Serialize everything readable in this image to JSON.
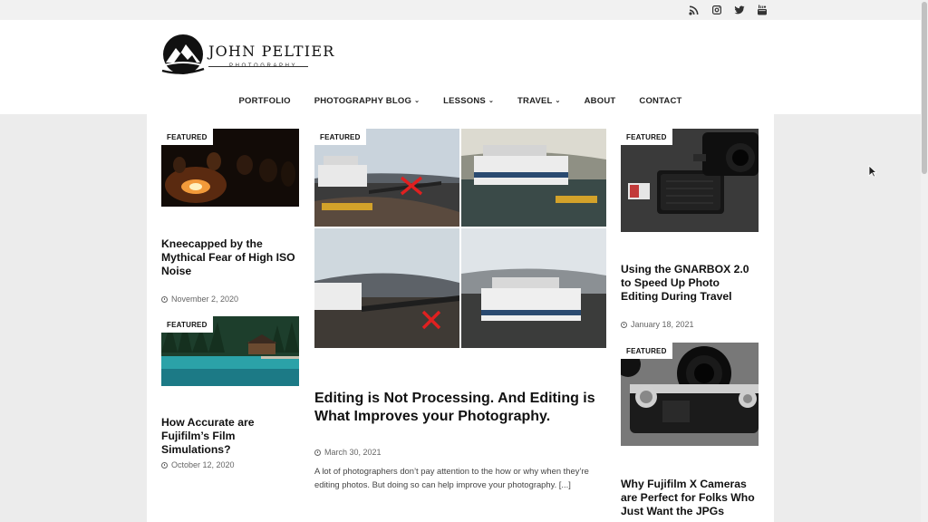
{
  "social": {
    "icons": [
      "rss-icon",
      "instagram-icon",
      "twitter-icon",
      "youtube-icon"
    ]
  },
  "logo": {
    "name": "JOHN PELTIER",
    "sub": "PHOTOGRAPHY"
  },
  "nav": {
    "items": [
      {
        "label": "PORTFOLIO",
        "dropdown": false
      },
      {
        "label": "PHOTOGRAPHY BLOG",
        "dropdown": true
      },
      {
        "label": "LESSONS",
        "dropdown": true
      },
      {
        "label": "TRAVEL",
        "dropdown": true
      },
      {
        "label": "ABOUT",
        "dropdown": false
      },
      {
        "label": "CONTACT",
        "dropdown": false
      }
    ],
    "caret": "⌄"
  },
  "posts": {
    "campfire": {
      "badge": "FEATURED",
      "title": "Kneecapped by the Mythical Fear of High ISO Noise",
      "date": "November 2, 2020"
    },
    "lake": {
      "badge": "FEATURED",
      "title": "How Accurate are Fujifilm’s Film Simulations?",
      "date": "October 12, 2020"
    },
    "editing": {
      "badge": "FEATURED",
      "title": "Editing is Not Processing. And Editing is What Improves your Photography.",
      "date": "March 30, 2021",
      "excerpt": "A lot of photographers don’t pay attention to the how or why when they’re editing photos. But doing so can help improve your photography. [...]"
    },
    "gnarbox": {
      "badge": "FEATURED",
      "title": "Using the GNARBOX 2.0 to Speed Up Photo Editing During Travel",
      "date": "January 18, 2021",
      "device_label": "GNARBOX"
    },
    "fujifilm": {
      "badge": "FEATURED",
      "title": "Why Fujifilm X Cameras are Perfect for Folks Who Just Want the JPGs"
    }
  },
  "colors": {
    "background": "#ececec",
    "content_bg": "#ffffff",
    "title": "#111111",
    "meta": "#666666",
    "red_x": "#e02020"
  }
}
